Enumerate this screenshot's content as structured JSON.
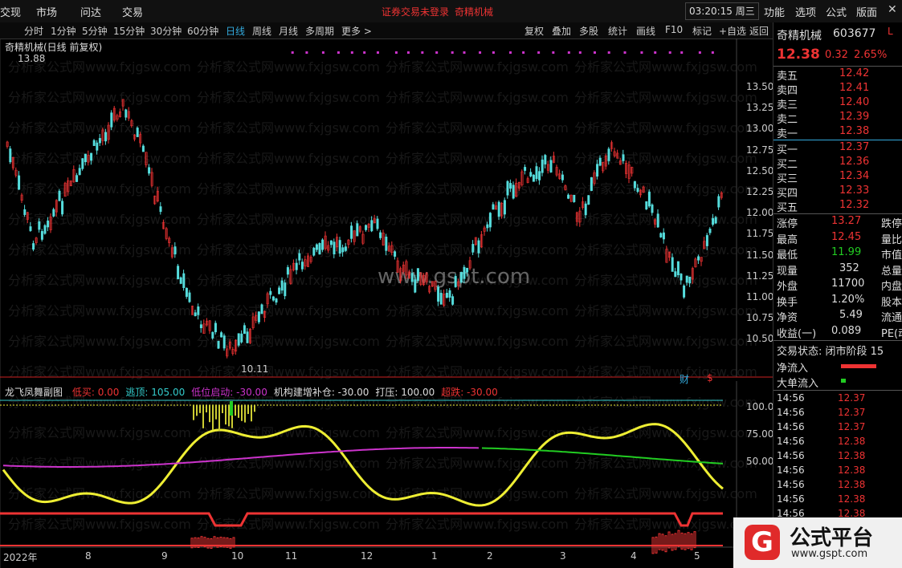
{
  "topbar": {
    "menus": [
      "交现",
      "市场",
      "问达",
      "交易"
    ],
    "notice_left": "证券交易未登录",
    "notice_right": "奇精机械",
    "clock": "03:20:15 周三",
    "right_menus": [
      "功能",
      "选项",
      "公式",
      "版面"
    ]
  },
  "tabs": [
    "分时",
    "1分钟",
    "5分钟",
    "15分钟",
    "30分钟",
    "60分钟",
    "日线",
    "周线",
    "月线",
    "多周期",
    "更多 >"
  ],
  "right_tabs": [
    "复权",
    "叠加",
    "多股",
    "统计",
    "画线",
    "F10",
    "标记",
    "+自选",
    "返回"
  ],
  "chart_title": "奇精机械(日线 前复权)",
  "y_axis": [
    "13.50",
    "13.25",
    "13.00",
    "12.75",
    "12.50",
    "12.25",
    "12.00",
    "11.75",
    "11.50",
    "11.25",
    "11.00",
    "10.75",
    "10.50"
  ],
  "high_label": "13.88",
  "low_label": "10.11",
  "markers": {
    "cai": "财",
    "s": "$"
  },
  "indicator": {
    "name": "龙飞凤舞副图",
    "items": [
      {
        "label": "低买: 0.00",
        "color": "#e33"
      },
      {
        "label": "逃顶: 105.00",
        "color": "#3cc"
      },
      {
        "label": "低位启动: -30.00",
        "color": "#c3c"
      },
      {
        "label": "机构建增补仓: -30.00",
        "color": "#ddd"
      },
      {
        "label": "打压: 100.00",
        "color": "#ddd"
      },
      {
        "label": "超跌: -30.00",
        "color": "#e33"
      }
    ],
    "y_axis": [
      "100.0",
      "75.00",
      "50.00"
    ]
  },
  "x_axis": [
    "2022年",
    "8",
    "9",
    "10",
    "11",
    "12",
    "1",
    "2",
    "3",
    "4",
    "5"
  ],
  "panel": {
    "name": "奇精机械",
    "code": "603677",
    "flag": "L",
    "price": "12.38",
    "change": "0.32",
    "pct": "2.65%",
    "asks": [
      [
        "卖五",
        "12.42"
      ],
      [
        "卖四",
        "12.41"
      ],
      [
        "卖三",
        "12.40"
      ],
      [
        "卖二",
        "12.39"
      ],
      [
        "卖一",
        "12.38"
      ]
    ],
    "bids": [
      [
        "买一",
        "12.37"
      ],
      [
        "买二",
        "12.36"
      ],
      [
        "买三",
        "12.34"
      ],
      [
        "买四",
        "12.33"
      ],
      [
        "买五",
        "12.32"
      ]
    ],
    "stats": [
      [
        "涨停",
        "13.27",
        "跌停"
      ],
      [
        "最高",
        "12.45",
        "量比"
      ],
      [
        "最低",
        "11.99",
        "市值"
      ],
      [
        "现量",
        "352",
        "总量"
      ],
      [
        "外盘",
        "11700",
        "内盘"
      ],
      [
        "换手",
        "1.20%",
        "股本"
      ],
      [
        "净资",
        "5.49",
        "流通"
      ],
      [
        "收益(一)",
        "0.089",
        "PE(动"
      ]
    ],
    "status": "交易状态: 闭市阶段 15",
    "flow1": "净流入",
    "flow2": "大单流入",
    "ticks": [
      [
        "14:56",
        "12.37"
      ],
      [
        "14:56",
        "12.37"
      ],
      [
        "14:56",
        "12.37"
      ],
      [
        "14:56",
        "12.38"
      ],
      [
        "14:56",
        "12.38"
      ],
      [
        "14:56",
        "12.38"
      ],
      [
        "14:56",
        "12.38"
      ],
      [
        "14:56",
        "12.38"
      ],
      [
        "14:56",
        "12.38"
      ]
    ]
  },
  "watermark": "分析家公式网www.fxjgsw.com",
  "site_wm": "www.gspt.com",
  "logo": {
    "name": "公式平台",
    "url": "www.gspt.com",
    "letter": "G"
  }
}
